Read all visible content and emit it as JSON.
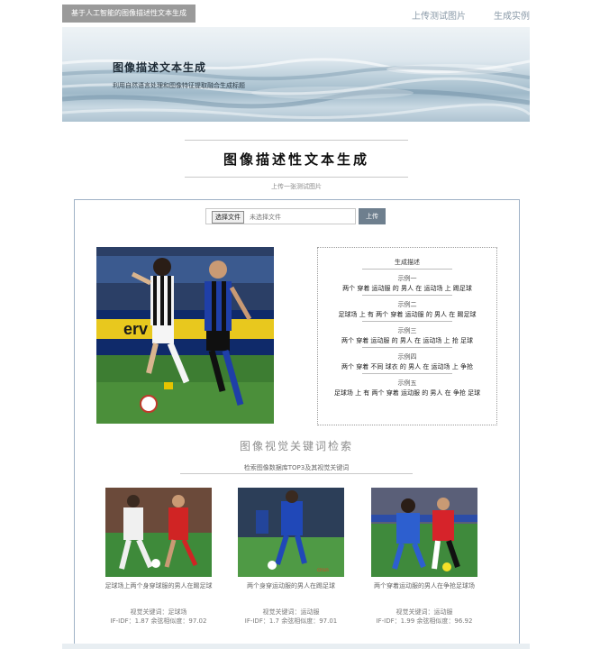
{
  "nav": {
    "brand": "基于人工智能的图像描述性文本生成",
    "links": [
      "上传测试图片",
      "生成实例"
    ]
  },
  "banner": {
    "title": "图像描述文本生成",
    "subtitle": "利用自然语言处理和图像特征提取融合生成标题"
  },
  "main": {
    "title": "图像描述性文本生成",
    "subtitle": "上传一张测试图片"
  },
  "upload": {
    "choose_file": "选择文件",
    "no_file": "未选择文件",
    "upload_button": "上传"
  },
  "description": {
    "title": "生成描述",
    "examples": [
      {
        "label": "示例一",
        "text": "两个 穿着 运动服 的 男人 在 运动场 上 踢足球"
      },
      {
        "label": "示例二",
        "text": "足球场 上 有 两个 穿着 运动服 的 男人 在 踢足球"
      },
      {
        "label": "示例三",
        "text": "两个 穿着 运动服 的 男人 在 运动场 上 抢 足球"
      },
      {
        "label": "示例四",
        "text": "两个 穿着 不同 球衣 的 男人 在 运动场 上 争抢"
      },
      {
        "label": "示例五",
        "text": "足球场 上 有 两个 穿着 运动服 的 男人 在 争抢 足球"
      }
    ]
  },
  "retrieval": {
    "title": "图像视觉关键词检索",
    "subtitle": "检索图像数据库TOP3及其视觉关键词",
    "results": [
      {
        "caption": "足球场上两个身穿球服的男人在踢足球",
        "keywords": "视觉关键词：足球场",
        "score": "IF-IDF：1.87 余弦相似度：97.02"
      },
      {
        "caption": "两个身穿运动服的男人在踢足球",
        "keywords": "视觉关键词：运动服",
        "score": "IF-IDF：1.7 余弦相似度：97.01"
      },
      {
        "caption": "两个穿着运动服的男人在争抢足球场",
        "keywords": "视觉关键词：运动服",
        "score": "IF-IDF：1.99 余弦相似度：96.92"
      }
    ]
  },
  "colors": {
    "brand_bg": "#9a9a9a",
    "nav_link": "#8a9aa8",
    "upload_button": "#6e7f8e",
    "panel_border": "#9fb2c6"
  }
}
